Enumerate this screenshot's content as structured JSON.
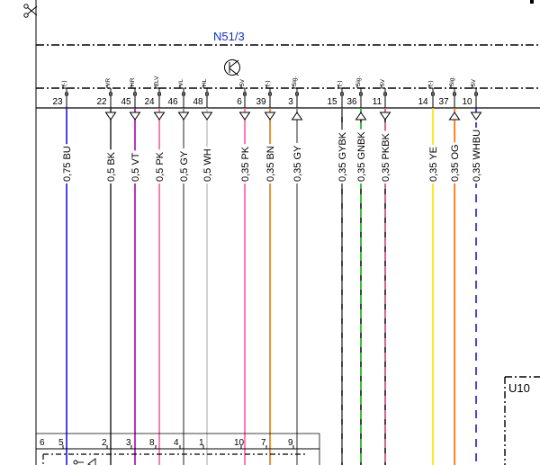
{
  "module": {
    "name": "N51/3",
    "color": "#1030c0"
  },
  "connector_u": {
    "label": "U10"
  },
  "pins": [
    {
      "num": "23",
      "label": "(-)",
      "wire": "0,75 BU",
      "color": "#1a1acc",
      "dash": "solid",
      "dir": "none"
    },
    {
      "num": "22",
      "label": "VR",
      "wire": "0,5 BK",
      "color": "#333333",
      "dash": "solid",
      "dir": "down"
    },
    {
      "num": "45",
      "label": "HR",
      "wire": "0,5 VT",
      "color": "#b000b0",
      "dash": "solid",
      "dir": "down"
    },
    {
      "num": "24",
      "label": "ZLV",
      "wire": "0,5 PK",
      "color": "#ff5aa0",
      "dash": "solid",
      "dir": "down"
    },
    {
      "num": "46",
      "label": "VL",
      "wire": "0,5 GY",
      "color": "#777777",
      "dash": "solid",
      "dir": "down"
    },
    {
      "num": "48",
      "label": "HL",
      "wire": "0,5 WH",
      "color": "#c8c8c8",
      "dash": "solid",
      "dir": "down"
    },
    {
      "num": "6",
      "label": "5V",
      "wire": "0,35 PK",
      "color": "#ff5aa0",
      "dash": "solid",
      "dir": "down"
    },
    {
      "num": "39",
      "label": "(-)",
      "wire": "0,35 BN",
      "color": "#e07818",
      "dash": "solid",
      "dir": "down"
    },
    {
      "num": "3",
      "label": "Sig.",
      "wire": "0,35 GY",
      "color": "#777777",
      "dash": "solid",
      "dir": "up"
    },
    {
      "num": "15",
      "label": "(-)",
      "wire": "0,35 GYBK",
      "color": "#777777",
      "dash": "gybk",
      "dir": "none"
    },
    {
      "num": "36",
      "label": "Sig.",
      "wire": "0,35 GNBK",
      "color": "#33cc33",
      "dash": "gnbk",
      "dir": "up"
    },
    {
      "num": "11",
      "label": "5V",
      "wire": "0,35 PKBK",
      "color": "#ff5aa0",
      "dash": "pkbk",
      "dir": "down"
    },
    {
      "num": "14",
      "label": "(-)",
      "wire": "0,35 YE",
      "color": "#ffe000",
      "dash": "solid",
      "dir": "none"
    },
    {
      "num": "37",
      "label": "Sig.",
      "wire": "0,35 OG",
      "color": "#ff6a00",
      "dash": "solid",
      "dir": "up"
    },
    {
      "num": "10",
      "label": "5V",
      "wire": "0,35 WHBU",
      "color": "#1a1acc",
      "dash": "whbu",
      "dir": "down"
    }
  ],
  "bottom_pins": [
    {
      "num": "6"
    },
    {
      "num": "5"
    },
    {
      "num": "2"
    },
    {
      "num": "3"
    },
    {
      "num": "8"
    },
    {
      "num": "4"
    },
    {
      "num": "1"
    },
    {
      "num": "10"
    },
    {
      "num": "7"
    },
    {
      "num": "9"
    }
  ]
}
